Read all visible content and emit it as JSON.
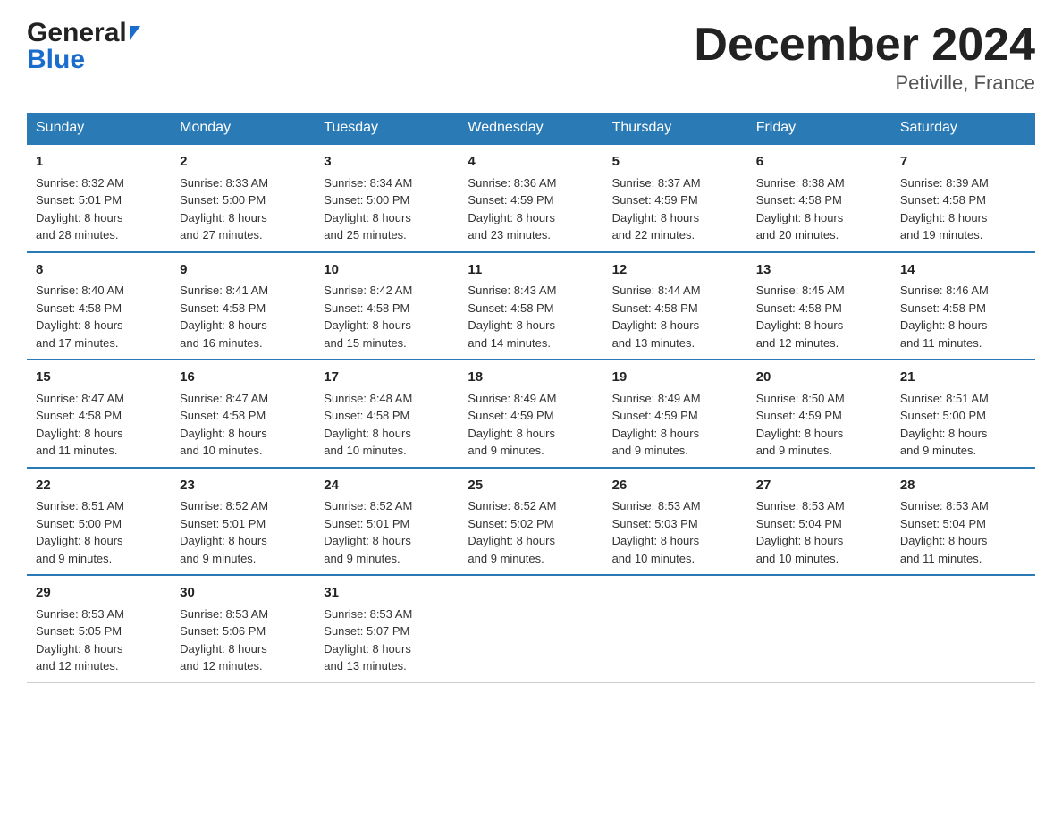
{
  "header": {
    "logo_general": "General",
    "logo_blue": "Blue",
    "month_title": "December 2024",
    "location": "Petiville, France"
  },
  "days_of_week": [
    "Sunday",
    "Monday",
    "Tuesday",
    "Wednesday",
    "Thursday",
    "Friday",
    "Saturday"
  ],
  "weeks": [
    [
      {
        "num": "1",
        "info": "Sunrise: 8:32 AM\nSunset: 5:01 PM\nDaylight: 8 hours\nand 28 minutes."
      },
      {
        "num": "2",
        "info": "Sunrise: 8:33 AM\nSunset: 5:00 PM\nDaylight: 8 hours\nand 27 minutes."
      },
      {
        "num": "3",
        "info": "Sunrise: 8:34 AM\nSunset: 5:00 PM\nDaylight: 8 hours\nand 25 minutes."
      },
      {
        "num": "4",
        "info": "Sunrise: 8:36 AM\nSunset: 4:59 PM\nDaylight: 8 hours\nand 23 minutes."
      },
      {
        "num": "5",
        "info": "Sunrise: 8:37 AM\nSunset: 4:59 PM\nDaylight: 8 hours\nand 22 minutes."
      },
      {
        "num": "6",
        "info": "Sunrise: 8:38 AM\nSunset: 4:58 PM\nDaylight: 8 hours\nand 20 minutes."
      },
      {
        "num": "7",
        "info": "Sunrise: 8:39 AM\nSunset: 4:58 PM\nDaylight: 8 hours\nand 19 minutes."
      }
    ],
    [
      {
        "num": "8",
        "info": "Sunrise: 8:40 AM\nSunset: 4:58 PM\nDaylight: 8 hours\nand 17 minutes."
      },
      {
        "num": "9",
        "info": "Sunrise: 8:41 AM\nSunset: 4:58 PM\nDaylight: 8 hours\nand 16 minutes."
      },
      {
        "num": "10",
        "info": "Sunrise: 8:42 AM\nSunset: 4:58 PM\nDaylight: 8 hours\nand 15 minutes."
      },
      {
        "num": "11",
        "info": "Sunrise: 8:43 AM\nSunset: 4:58 PM\nDaylight: 8 hours\nand 14 minutes."
      },
      {
        "num": "12",
        "info": "Sunrise: 8:44 AM\nSunset: 4:58 PM\nDaylight: 8 hours\nand 13 minutes."
      },
      {
        "num": "13",
        "info": "Sunrise: 8:45 AM\nSunset: 4:58 PM\nDaylight: 8 hours\nand 12 minutes."
      },
      {
        "num": "14",
        "info": "Sunrise: 8:46 AM\nSunset: 4:58 PM\nDaylight: 8 hours\nand 11 minutes."
      }
    ],
    [
      {
        "num": "15",
        "info": "Sunrise: 8:47 AM\nSunset: 4:58 PM\nDaylight: 8 hours\nand 11 minutes."
      },
      {
        "num": "16",
        "info": "Sunrise: 8:47 AM\nSunset: 4:58 PM\nDaylight: 8 hours\nand 10 minutes."
      },
      {
        "num": "17",
        "info": "Sunrise: 8:48 AM\nSunset: 4:58 PM\nDaylight: 8 hours\nand 10 minutes."
      },
      {
        "num": "18",
        "info": "Sunrise: 8:49 AM\nSunset: 4:59 PM\nDaylight: 8 hours\nand 9 minutes."
      },
      {
        "num": "19",
        "info": "Sunrise: 8:49 AM\nSunset: 4:59 PM\nDaylight: 8 hours\nand 9 minutes."
      },
      {
        "num": "20",
        "info": "Sunrise: 8:50 AM\nSunset: 4:59 PM\nDaylight: 8 hours\nand 9 minutes."
      },
      {
        "num": "21",
        "info": "Sunrise: 8:51 AM\nSunset: 5:00 PM\nDaylight: 8 hours\nand 9 minutes."
      }
    ],
    [
      {
        "num": "22",
        "info": "Sunrise: 8:51 AM\nSunset: 5:00 PM\nDaylight: 8 hours\nand 9 minutes."
      },
      {
        "num": "23",
        "info": "Sunrise: 8:52 AM\nSunset: 5:01 PM\nDaylight: 8 hours\nand 9 minutes."
      },
      {
        "num": "24",
        "info": "Sunrise: 8:52 AM\nSunset: 5:01 PM\nDaylight: 8 hours\nand 9 minutes."
      },
      {
        "num": "25",
        "info": "Sunrise: 8:52 AM\nSunset: 5:02 PM\nDaylight: 8 hours\nand 9 minutes."
      },
      {
        "num": "26",
        "info": "Sunrise: 8:53 AM\nSunset: 5:03 PM\nDaylight: 8 hours\nand 10 minutes."
      },
      {
        "num": "27",
        "info": "Sunrise: 8:53 AM\nSunset: 5:04 PM\nDaylight: 8 hours\nand 10 minutes."
      },
      {
        "num": "28",
        "info": "Sunrise: 8:53 AM\nSunset: 5:04 PM\nDaylight: 8 hours\nand 11 minutes."
      }
    ],
    [
      {
        "num": "29",
        "info": "Sunrise: 8:53 AM\nSunset: 5:05 PM\nDaylight: 8 hours\nand 12 minutes."
      },
      {
        "num": "30",
        "info": "Sunrise: 8:53 AM\nSunset: 5:06 PM\nDaylight: 8 hours\nand 12 minutes."
      },
      {
        "num": "31",
        "info": "Sunrise: 8:53 AM\nSunset: 5:07 PM\nDaylight: 8 hours\nand 13 minutes."
      },
      null,
      null,
      null,
      null
    ]
  ]
}
